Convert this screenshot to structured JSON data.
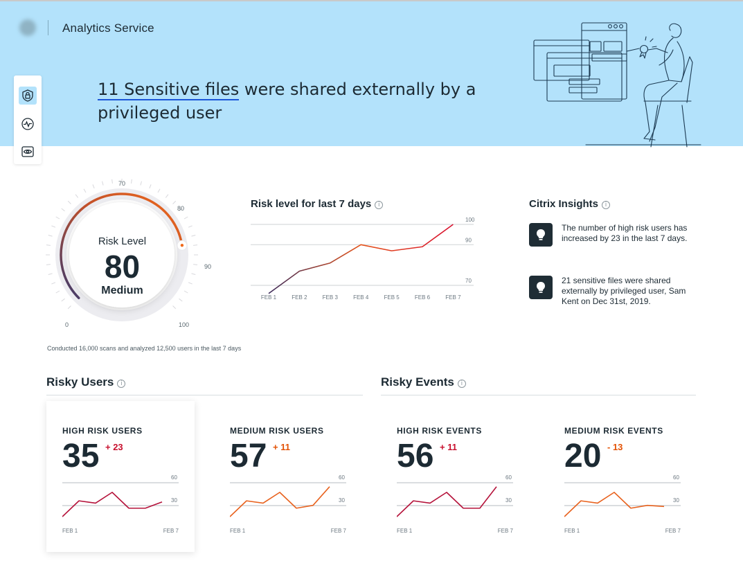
{
  "app": {
    "title": "Analytics Service"
  },
  "hero": {
    "headline_highlight": "11 Sensitive files",
    "headline_rest": " were shared externally by a privileged user"
  },
  "rail": {
    "items": [
      "lock-shield-icon",
      "activity-icon",
      "eye-icon"
    ]
  },
  "gauge": {
    "label": "Risk Level",
    "value": 80,
    "level": "Medium",
    "min": 0,
    "max": 100,
    "ticks": [
      "0",
      "70",
      "80",
      "90",
      "100"
    ],
    "note": "Conducted 16,000 scans and analyzed 12,500 users in the last 7 days",
    "colors": {
      "start": "#3b3a6e",
      "end": "#f06a1b",
      "track": "#ececf0"
    }
  },
  "trend": {
    "title": "Risk level for last 7 days",
    "chart_data": {
      "type": "line",
      "categories": [
        "FEB 1",
        "FEB 2",
        "FEB 3",
        "FEB 4",
        "FEB 5",
        "FEB 6",
        "FEB 7"
      ],
      "values": [
        66,
        77,
        81,
        90,
        87,
        89,
        100
      ],
      "ylim": [
        70,
        100
      ],
      "yticks": [
        "70",
        "90",
        "100"
      ],
      "colors": {
        "start": "#3b2a5a",
        "mid": "#e5541a",
        "end": "#d8102f"
      }
    }
  },
  "insights": {
    "title": "Citrix Insights",
    "items": [
      {
        "icon": "lightbulb-icon",
        "text": "The number of high risk users has increased by 23 in the last 7 days."
      },
      {
        "icon": "lightbulb-icon",
        "text": "21 sensitive files were shared externally by privileged user, Sam Kent on Dec 31st, 2019."
      }
    ]
  },
  "risky_users": {
    "title": "Risky Users",
    "cards": [
      {
        "title": "HIGH RISK USERS",
        "value": "35",
        "delta": "+ 23",
        "delta_color": "#c8102e",
        "line_color": "#b5123a",
        "chart_data": {
          "type": "line",
          "x_start": "FEB 1",
          "x_end": "FEB 7",
          "yticks": [
            "30",
            "60"
          ],
          "ylim": [
            0,
            60
          ],
          "values": [
            0,
            28,
            24,
            43,
            15,
            15,
            26
          ]
        }
      },
      {
        "title": "MEDIUM RISK USERS",
        "value": "57",
        "delta": "+ 11",
        "delta_color": "#e35205",
        "line_color": "#e8621e",
        "chart_data": {
          "type": "line",
          "x_start": "FEB 1",
          "x_end": "FEB 7",
          "yticks": [
            "30",
            "60"
          ],
          "ylim": [
            0,
            60
          ],
          "values": [
            0,
            28,
            24,
            43,
            15,
            20,
            53
          ]
        }
      }
    ]
  },
  "risky_events": {
    "title": "Risky Events",
    "cards": [
      {
        "title": "HIGH RISK EVENTS",
        "value": "56",
        "delta": "+ 11",
        "delta_color": "#c8102e",
        "line_color": "#b5123a",
        "chart_data": {
          "type": "line",
          "x_start": "FEB 1",
          "x_end": "FEB 7",
          "yticks": [
            "30",
            "60"
          ],
          "ylim": [
            0,
            60
          ],
          "values": [
            0,
            28,
            24,
            43,
            15,
            15,
            53
          ]
        }
      },
      {
        "title": "MEDIUM RISK EVENTS",
        "value": "20",
        "delta": "- 13",
        "delta_color": "#e35205",
        "line_color": "#e8621e",
        "chart_data": {
          "type": "line",
          "x_start": "FEB 1",
          "x_end": "FEB 7",
          "yticks": [
            "30",
            "60"
          ],
          "ylim": [
            0,
            60
          ],
          "values": [
            0,
            28,
            24,
            43,
            15,
            20,
            18
          ]
        }
      }
    ]
  }
}
